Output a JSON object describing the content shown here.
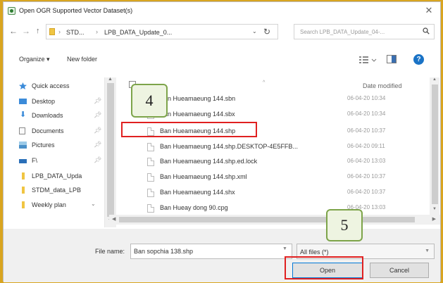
{
  "window": {
    "title": "Open OGR Supported Vector Dataset(s)",
    "close_glyph": "✕"
  },
  "address": {
    "segments": [
      "STD...",
      "LPB_DATA_Update_0..."
    ],
    "separator": "›",
    "search_placeholder": "Search LPB_DATA_Update_04-..."
  },
  "toolbar": {
    "organize": "Organize ▾",
    "new_folder": "New folder"
  },
  "sidebar": {
    "items": [
      {
        "label": "Quick access",
        "icon": "star-icon",
        "color": "#3b8bd9"
      },
      {
        "label": "Desktop",
        "icon": "desktop-icon",
        "color": "#3b8bd9",
        "pinned": true
      },
      {
        "label": "Downloads",
        "icon": "downloads-icon",
        "color": "#3b8bd9",
        "pinned": true
      },
      {
        "label": "Documents",
        "icon": "documents-icon",
        "color": "#8a8a8a",
        "pinned": true
      },
      {
        "label": "Pictures",
        "icon": "pictures-icon",
        "color": "#4a90c8",
        "pinned": true
      },
      {
        "label": "F\\",
        "icon": "drive-icon",
        "color": "#2a6fb8",
        "pinned": true
      },
      {
        "label": "LPB_DATA_Upda",
        "icon": "folder-icon",
        "color": "#f0c542"
      },
      {
        "label": "STDM_data_LPB",
        "icon": "folder-icon",
        "color": "#f0c542"
      },
      {
        "label": "Weekly plan",
        "icon": "folder-icon",
        "color": "#f0c542"
      }
    ]
  },
  "filelist": {
    "date_header": "Date modified",
    "rows": [
      {
        "name": "Ban Hueamaeung 144.sbn",
        "date": "06-04-20 10:34"
      },
      {
        "name": "Ban Hueamaeung 144.sbx",
        "date": "06-04-20 10:34"
      },
      {
        "name": "Ban Hueamaeung 144.shp",
        "date": "06-04-20 10:37"
      },
      {
        "name": "Ban Hueamaeung 144.shp.DESKTOP-4E5FFB...",
        "date": "06-04-20 09:11"
      },
      {
        "name": "Ban Hueamaeung 144.shp.ed.lock",
        "date": "06-04-20 13:03"
      },
      {
        "name": "Ban Hueamaeung 144.shp.xml",
        "date": "06-04-20 10:37"
      },
      {
        "name": "Ban Hueamaeung 144.shx",
        "date": "06-04-20 10:37"
      },
      {
        "name": "Ban Hueay dong 90.cpg",
        "date": "06-04-20 13:03"
      }
    ]
  },
  "bottom": {
    "file_name_label": "File name:",
    "file_name_value": "Ban sopchia 138.shp",
    "filter": "All files (*)",
    "open": "Open",
    "cancel": "Cancel"
  },
  "annotations": {
    "step4": "4",
    "step5": "5",
    "highlight_color": "#e02020",
    "callout_border": "#7da44a"
  },
  "accent": "#0078d7"
}
